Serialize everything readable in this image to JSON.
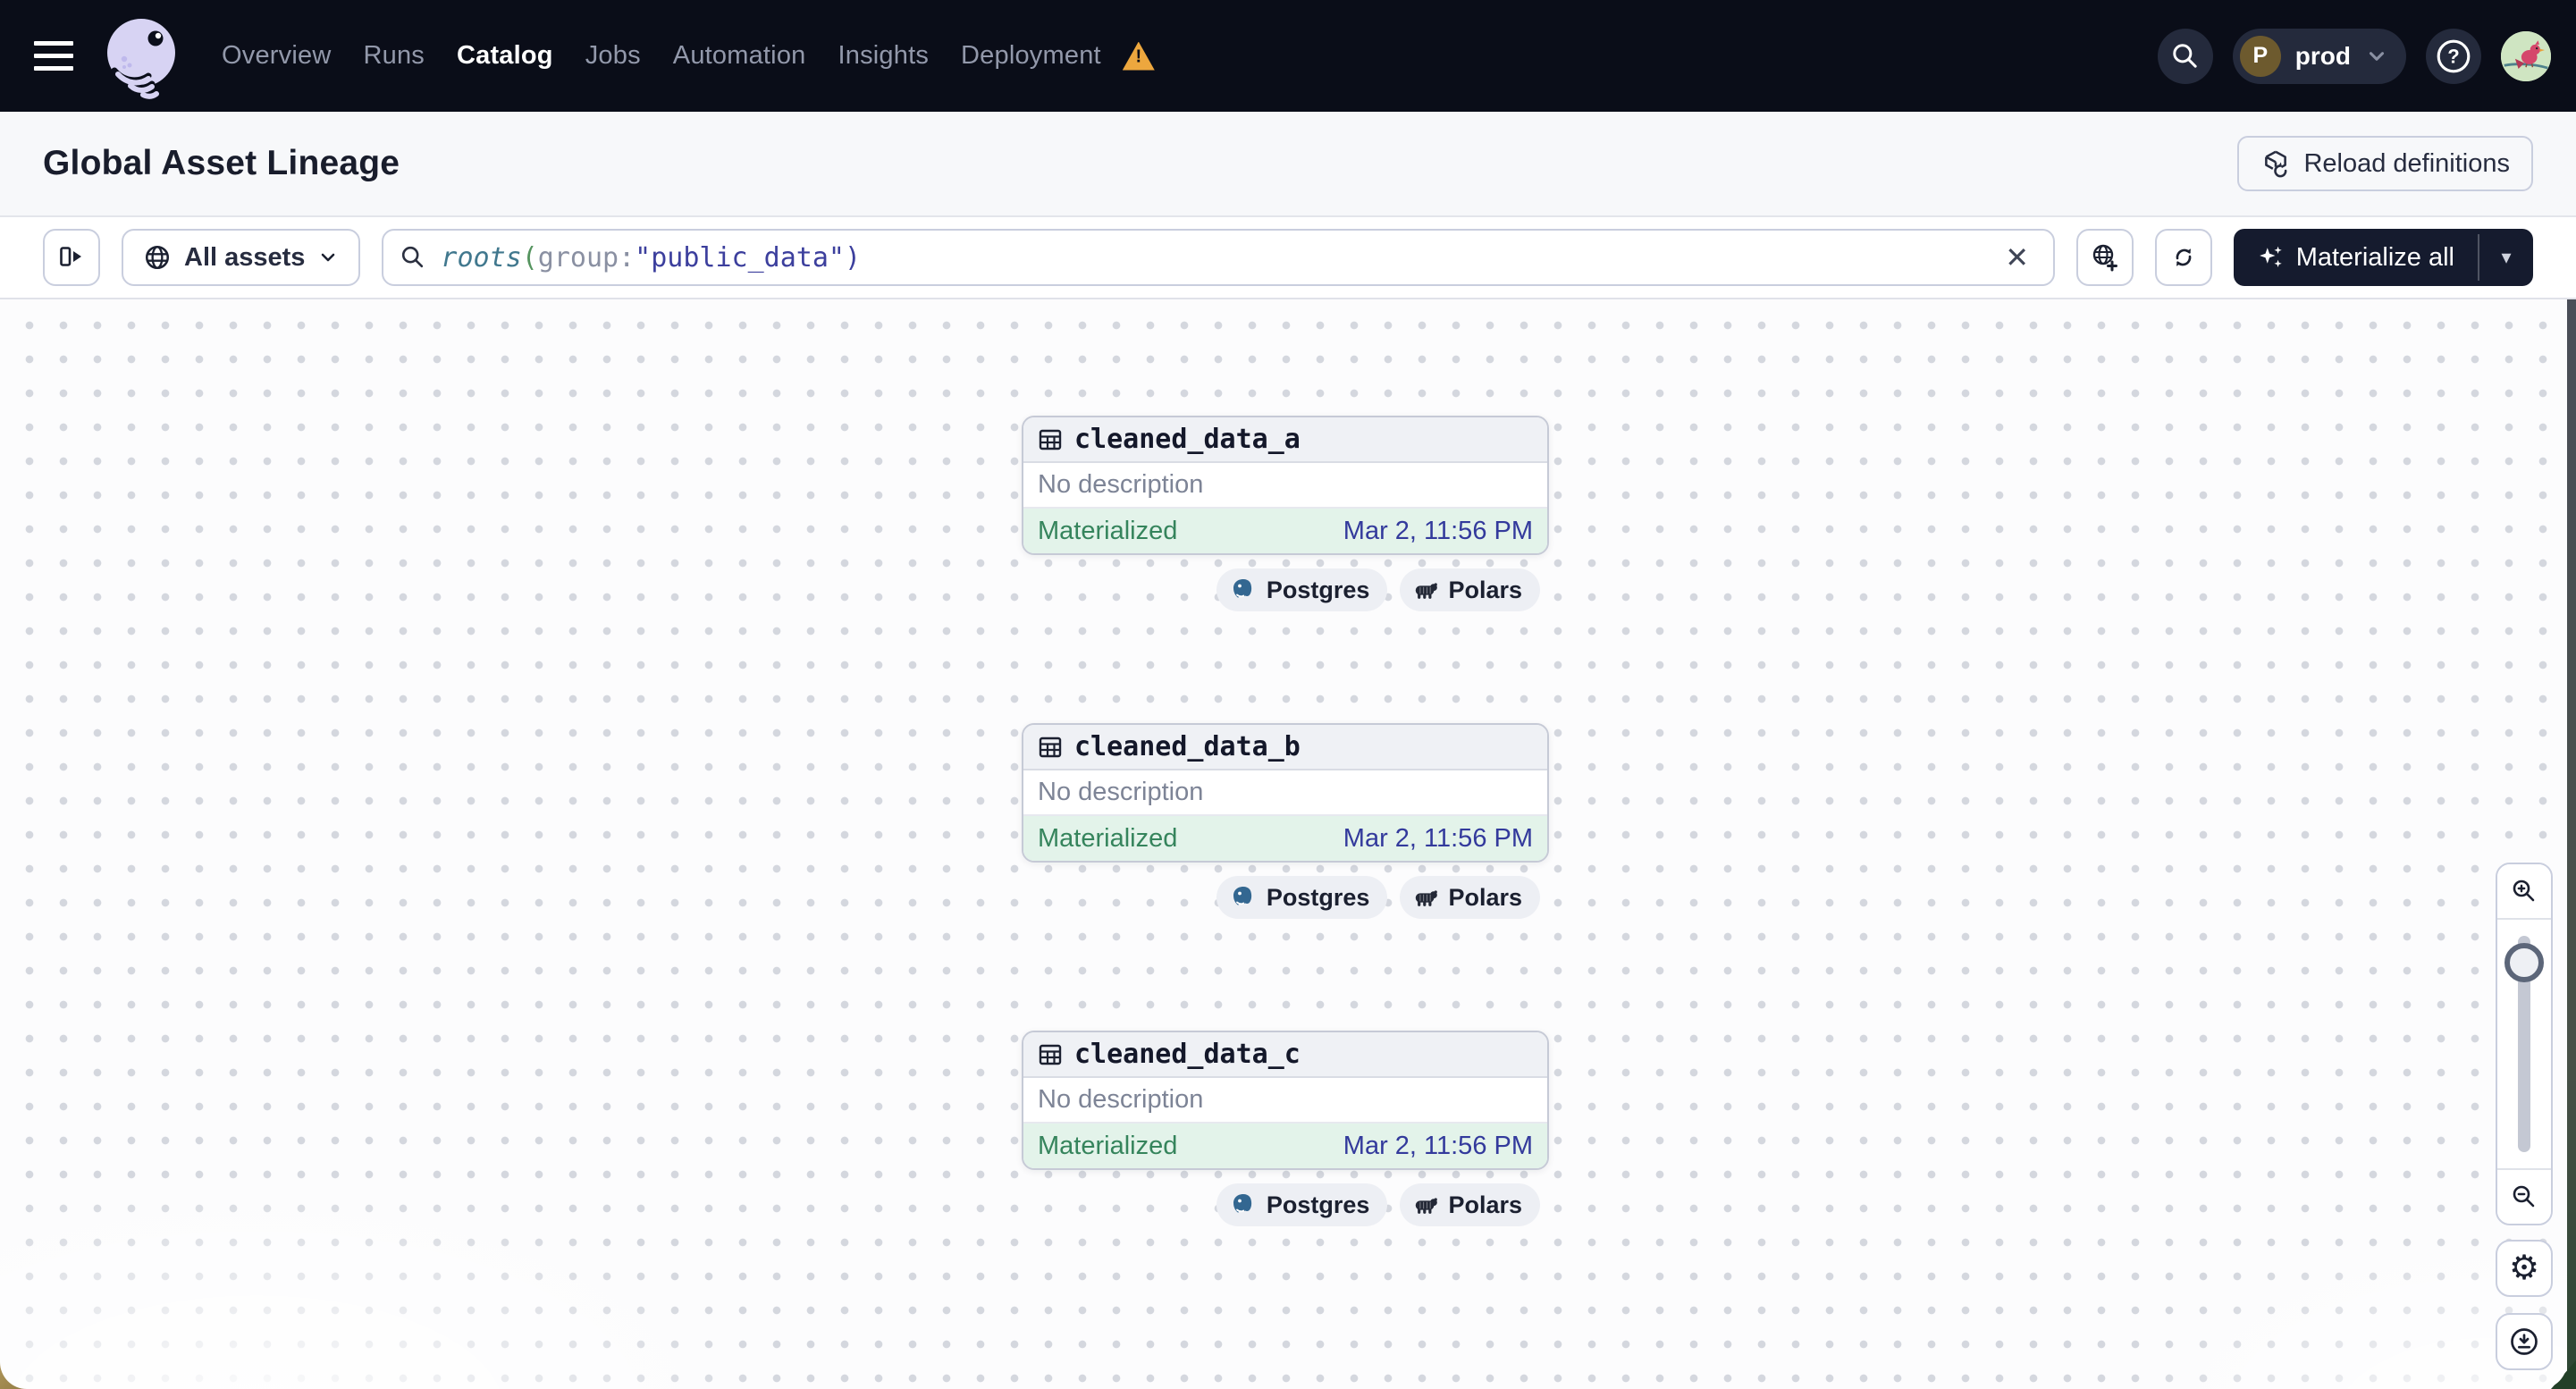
{
  "topnav": {
    "menu_items": [
      "Overview",
      "Runs",
      "Catalog",
      "Jobs",
      "Automation",
      "Insights",
      "Deployment"
    ],
    "active_item": "Catalog",
    "warning_glyph": "!",
    "environment": {
      "initial": "P",
      "label": "prod"
    }
  },
  "page_header": {
    "title": "Global Asset Lineage",
    "reload_button": "Reload definitions"
  },
  "toolbar": {
    "scope_button": "All assets",
    "search": {
      "fn": "roots",
      "paren_open": "(",
      "attr": "group",
      "colon": ":",
      "value": "\"public_data\"",
      "paren_close": ")"
    },
    "clear_glyph": "✕",
    "materialize_button": "Materialize all",
    "caret_glyph": "▾"
  },
  "graph": {
    "nodes": [
      {
        "name": "cleaned_data_a",
        "description": "No description",
        "status": "Materialized",
        "timestamp": "Mar 2, 11:56 PM",
        "tags": [
          {
            "label": "Postgres"
          },
          {
            "label": "Polars"
          }
        ]
      },
      {
        "name": "cleaned_data_b",
        "description": "No description",
        "status": "Materialized",
        "timestamp": "Mar 2, 11:56 PM",
        "tags": [
          {
            "label": "Postgres"
          },
          {
            "label": "Polars"
          }
        ]
      },
      {
        "name": "cleaned_data_c",
        "description": "No description",
        "status": "Materialized",
        "timestamp": "Mar 2, 11:56 PM",
        "tags": [
          {
            "label": "Postgres"
          },
          {
            "label": "Polars"
          }
        ]
      }
    ]
  },
  "controls": {
    "gear_glyph": "⚙"
  },
  "colors": {
    "nav_bg": "#0a0d18",
    "accent_green": "#35845c",
    "footer_bg": "#e3f3ea",
    "timestamp_blue": "#333a9c",
    "materialize_bg": "#151b2e",
    "warning_orange": "#eda73e",
    "postgres_blue": "#336791"
  }
}
